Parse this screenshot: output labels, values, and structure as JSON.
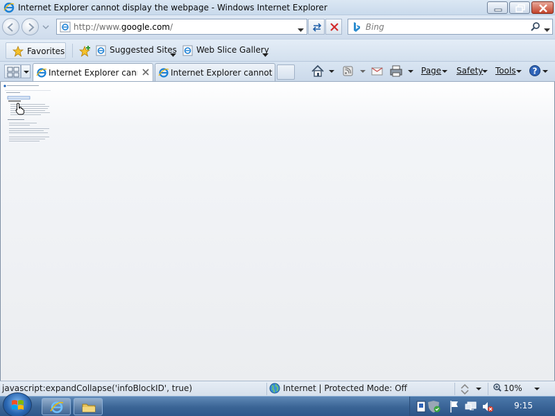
{
  "window": {
    "title": "Internet Explorer cannot display the webpage - Windows Internet Explorer"
  },
  "navigation": {
    "url_prefix": "http://www.",
    "url_domain": "google.com",
    "url_suffix": "/",
    "search_placeholder": "Bing"
  },
  "favorites_bar": {
    "favorites_label": "Favorites",
    "items": [
      {
        "label": "Suggested Sites"
      },
      {
        "label": "Web Slice Gallery"
      }
    ]
  },
  "tabs": [
    {
      "label": "Internet Explorer cann...",
      "active": true
    },
    {
      "label": "Internet Explorer cannot d...",
      "active": false
    }
  ],
  "command_bar": {
    "page_label": "Page",
    "safety_label": "Safety",
    "tools_label": "Tools"
  },
  "status_bar": {
    "status_text": "javascript:expandCollapse('infoBlockID', true)",
    "zone_text": "Internet | Protected Mode: Off",
    "zoom_text": "10%"
  },
  "taskbar": {
    "clock": "9:15"
  },
  "colors": {
    "title_text": "#0b0b0b",
    "accent_blue": "#1a5fb4",
    "close_button": "#c2432a",
    "taskbar": "#3a6495"
  },
  "icons": [
    "ie-icon",
    "back-icon",
    "forward-icon",
    "refresh-icon",
    "stop-icon",
    "bing-icon",
    "search-icon",
    "star-icon",
    "add-favorite-icon",
    "home-icon",
    "feeds-icon",
    "mail-icon",
    "print-icon",
    "help-icon",
    "globe-icon",
    "zoom-icon",
    "windows-start-icon",
    "folder-icon"
  ]
}
